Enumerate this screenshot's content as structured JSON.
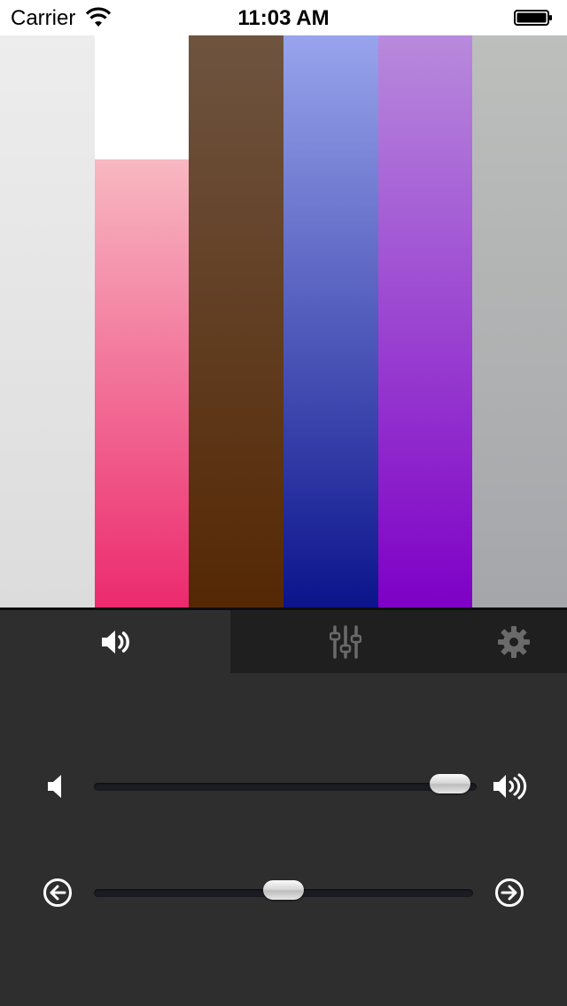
{
  "status_bar": {
    "carrier": "Carrier",
    "time": "11:03 AM",
    "wifi_icon": "wifi-icon",
    "battery_icon": "battery-icon"
  },
  "color_bars": [
    {
      "name": "white",
      "level": 1.0,
      "top": "#ededed",
      "bottom": "#dcdcdc"
    },
    {
      "name": "pink",
      "level": 0.783,
      "top": "#f8b8c2",
      "bottom": "#ec2a6e"
    },
    {
      "name": "brown",
      "level": 1.0,
      "top": "#6e5440",
      "bottom": "#552804"
    },
    {
      "name": "blue",
      "level": 1.0,
      "top": "#98a4ec",
      "bottom": "#0c148c"
    },
    {
      "name": "purple",
      "level": 1.0,
      "top": "#b88adc",
      "bottom": "#7e00c6"
    },
    {
      "name": "gray",
      "level": 1.0,
      "top": "#bcbfbc",
      "bottom": "#a5a6aa"
    }
  ],
  "tabs": [
    {
      "name": "tab-volume",
      "icon": "speaker-icon",
      "active": true
    },
    {
      "name": "tab-equalizer",
      "icon": "equalizer-icon",
      "active": false
    },
    {
      "name": "tab-settings",
      "icon": "gear-icon",
      "active": false
    }
  ],
  "sliders": {
    "volume": {
      "value": 0.93,
      "min_icon": "speaker-low-icon",
      "max_icon": "speaker-high-icon"
    },
    "position": {
      "value": 0.5,
      "min_icon": "arrow-left-circle-icon",
      "max_icon": "arrow-right-circle-icon"
    }
  },
  "colors": {
    "panel_bg": "#2e2e2e",
    "tabbar_bg": "#1f1f1f",
    "active_icon": "#ffffff",
    "inactive_icon": "#6a6a6a"
  }
}
